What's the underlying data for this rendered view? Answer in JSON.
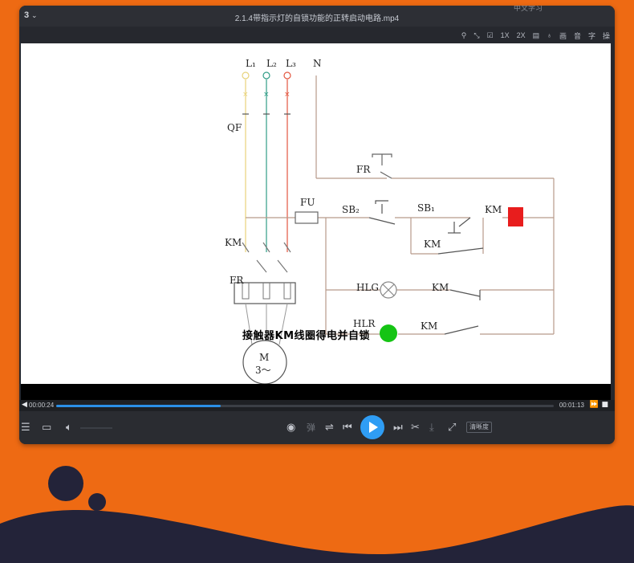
{
  "window": {
    "logo": "3",
    "title": "2.1.4带指示灯的自锁功能的正转启动电路.mp4",
    "watermark": "中文学习"
  },
  "toolbar": {
    "speed_1x": "1X",
    "speed_2x": "2X",
    "picture_label": "画",
    "audio_label": "音",
    "subtitle_label": "字",
    "operate_label": "操"
  },
  "video": {
    "labels": {
      "l1": "L₁",
      "l2": "L₂",
      "l3": "L₃",
      "n": "N",
      "qf": "QF",
      "fr_top": "FR",
      "fu": "FU",
      "sb2": "SB₂",
      "sb1": "SB₁",
      "km_coil": "KM",
      "km_self": "KM",
      "km_main": "KM",
      "fr_relay": "FR",
      "hlg": "HLG",
      "km_hlg": "KM",
      "hlr": "HLR",
      "km_hlr": "KM",
      "motor_m": "M",
      "motor_3": "3～"
    },
    "subtitle": "接触器KM线圈得电并自锁",
    "colors": {
      "l1": "#e8d27a",
      "l2": "#2f9c86",
      "l3": "#e3563f",
      "wire": "#b89a8a",
      "coil": "#e81d1d",
      "lamp_green": "#15c414"
    }
  },
  "playback": {
    "current_time": "00:00:24",
    "total_time": "00:01:13",
    "progress": 0.33,
    "quality_label": "清晰度",
    "danmaku_label": "弹"
  },
  "icons": {
    "pin": "pin-icon",
    "fullscreen": "fullscreen-icon",
    "screenshot": "screenshot-icon",
    "playlist": "playlist-icon",
    "open": "folder-icon",
    "volume": "volume-icon",
    "eye": "eye-icon",
    "settings": "equalizer-icon",
    "prev": "prev-icon",
    "play": "play-icon",
    "next": "next-icon",
    "cut": "scissors-icon",
    "download": "download-icon",
    "expand": "expand-icon"
  },
  "decor": {
    "navy": "#232339"
  }
}
